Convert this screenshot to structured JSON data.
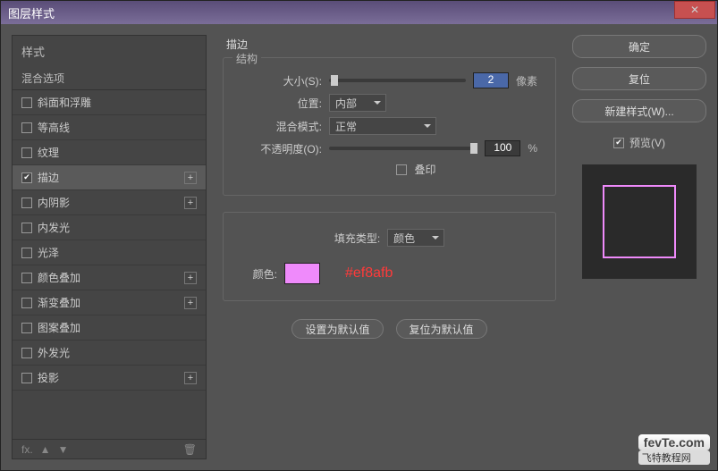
{
  "window": {
    "title": "图层样式"
  },
  "close_icon": "✕",
  "sidebar": {
    "header": "样式",
    "sub_header": "混合选项",
    "items": [
      {
        "label": "斜面和浮雕",
        "checked": false,
        "plus": false
      },
      {
        "label": "等高线",
        "checked": false,
        "plus": false
      },
      {
        "label": "纹理",
        "checked": false,
        "plus": false
      },
      {
        "label": "描边",
        "checked": true,
        "plus": true,
        "active": true
      },
      {
        "label": "内阴影",
        "checked": false,
        "plus": true
      },
      {
        "label": "内发光",
        "checked": false,
        "plus": false
      },
      {
        "label": "光泽",
        "checked": false,
        "plus": false
      },
      {
        "label": "颜色叠加",
        "checked": false,
        "plus": true
      },
      {
        "label": "渐变叠加",
        "checked": false,
        "plus": true
      },
      {
        "label": "图案叠加",
        "checked": false,
        "plus": false
      },
      {
        "label": "外发光",
        "checked": false,
        "plus": false
      },
      {
        "label": "投影",
        "checked": false,
        "plus": true
      }
    ],
    "footer_icons": {
      "fx": "fx.",
      "up": "▲",
      "down": "▼",
      "trash": "🗑"
    }
  },
  "center": {
    "title": "描边",
    "structure_label": "结构",
    "size": {
      "label": "大小(S):",
      "value": "2",
      "unit": "像素",
      "thumb_pos": "1%"
    },
    "position": {
      "label": "位置:",
      "value": "内部"
    },
    "blend": {
      "label": "混合模式:",
      "value": "正常"
    },
    "opacity": {
      "label": "不透明度(O):",
      "value": "100",
      "unit": "%",
      "thumb_pos": "100%"
    },
    "overprint": {
      "label": "叠印"
    },
    "fill": {
      "label": "填充类型:",
      "value": "颜色"
    },
    "color": {
      "label": "颜色:",
      "hex": "#ef8afb"
    },
    "defaults": {
      "set": "设置为默认值",
      "reset": "复位为默认值"
    }
  },
  "right": {
    "ok": "确定",
    "cancel": "复位",
    "new_style": "新建样式(W)...",
    "preview": {
      "label": "预览(V)",
      "checked": true
    }
  },
  "watermark": {
    "logo": "fevTe.com",
    "sub": "飞特教程网"
  }
}
